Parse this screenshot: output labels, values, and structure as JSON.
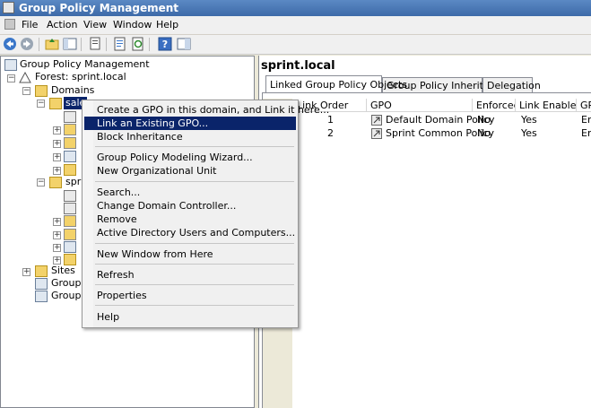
{
  "window": {
    "title": "Group Policy Management"
  },
  "menubar": [
    "File",
    "Action",
    "View",
    "Window",
    "Help"
  ],
  "tree": {
    "root": "Group Policy Management",
    "forest": "Forest: sprint.local",
    "domains": "Domains",
    "selected_node_prefix": "sale",
    "domain_sprint_prefix": "spri",
    "sites": "Sites",
    "gp_modeling_prefix": "Group P",
    "gp_results_prefix": "Group P"
  },
  "right": {
    "title": "sprint.local",
    "tabs": [
      "Linked Group Policy Objects",
      "Group Policy Inheritance",
      "Delegation"
    ],
    "columns": [
      "Link Order",
      "GPO",
      "Enforced",
      "Link Enabled",
      "GP"
    ],
    "rows": [
      {
        "order": "1",
        "gpo": "Default Domain Policy",
        "enforced": "No",
        "enabled": "Yes",
        "gp": "En"
      },
      {
        "order": "2",
        "gpo": "Sprint Common Policy",
        "enforced": "No",
        "enabled": "Yes",
        "gp": "En"
      }
    ]
  },
  "context_menu": {
    "items": [
      "Create a GPO in this domain, and Link it here...",
      "Link an Existing GPO...",
      "Block Inheritance",
      "Group Policy Modeling Wizard...",
      "New Organizational Unit",
      "Search...",
      "Change Domain Controller...",
      "Remove",
      "Active Directory Users and Computers...",
      "New Window from Here",
      "Refresh",
      "Properties",
      "Help"
    ],
    "highlighted_index": 1
  },
  "colors": {
    "selection": "#0a246a",
    "titlebar": "#3d6aa8"
  }
}
